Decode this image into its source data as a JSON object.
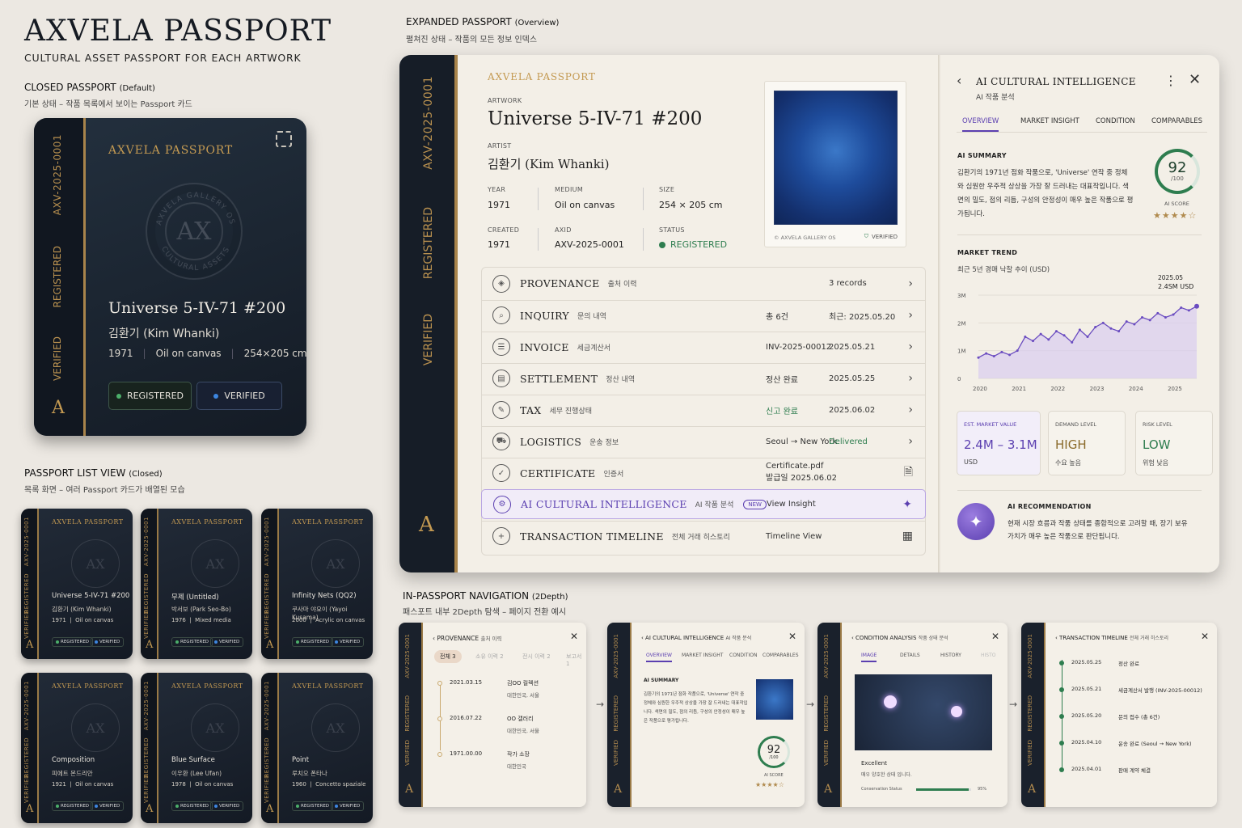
{
  "header": {
    "title": "AXVELA PASSPORT",
    "subtitle": "CULTURAL ASSET PASSPORT FOR EACH ARTWORK"
  },
  "closed": {
    "heading": "CLOSED PASSPORT",
    "heading_note": "(Default)",
    "desc": "기본 상태 – 작품 목록에서 보이는 Passport 카드",
    "spine": [
      "AXV-2025-0001",
      "REGISTERED",
      "VERIFIED"
    ],
    "brand": "AXVELA PASSPORT",
    "seal": "AX",
    "seal_ring_top": "AXVELA GALLERY OS",
    "seal_ring_bottom": "CULTURAL ASSETS",
    "title": "Universe 5-IV-71 #200",
    "artist": "김환기 (Kim Whanki)",
    "year": "1971",
    "medium": "Oil on canvas",
    "size": "254×205 cm",
    "badge1": "REGISTERED",
    "badge2": "VERIFIED",
    "logo": "A"
  },
  "list": {
    "heading": "PASSPORT LIST VIEW",
    "heading_note": "(Closed)",
    "desc": "목록 화면 – 여러 Passport 카드가 배열된 모습",
    "cards": [
      {
        "brand": "AXVELA PASSPORT",
        "spine": "AXV-2025-0001",
        "title": "Universe 5-IV-71 #200",
        "artist": "김환기 (Kim Whanki)",
        "year": "1971",
        "medium": "Oil on canvas",
        "b1": "REGISTERED",
        "b2": "VERIFIED"
      },
      {
        "brand": "AXVELA PASSPORT",
        "spine": "AXV-2025-0001",
        "title": "무제 (Untitled)",
        "artist": "박서보 (Park Seo-Bo)",
        "year": "1976",
        "medium": "Mixed media",
        "b1": "REGISTERED",
        "b2": "VERIFIED"
      },
      {
        "brand": "AXVELA PASSPORT",
        "spine": "AXV-2025-0001",
        "title": "Infinity Nets (QQ2)",
        "artist": "쿠사마 야요이 (Yayoi Kusama)",
        "year": "2000",
        "medium": "Acrylic on canvas",
        "b1": "REGISTERED",
        "b2": "VERIFIED"
      },
      {
        "brand": "AXVELA PASSPORT",
        "spine": "AXV-2025-0001",
        "title": "Composition",
        "artist": "피에트 몬드리안",
        "year": "1921",
        "medium": "Oil on canvas",
        "b1": "REGISTERED",
        "b2": "VERIFIED"
      },
      {
        "brand": "AXVELA PASSPORT",
        "spine": "AXV-2025-0001",
        "title": "Blue Surface",
        "artist": "이우환 (Lee Ufan)",
        "year": "1978",
        "medium": "Oil on canvas",
        "b1": "REGISTERED",
        "b2": "VERIFIED"
      },
      {
        "brand": "AXVELA PASSPORT",
        "spine": "AXV-2025-0001",
        "title": "Point",
        "artist": "루치오 폰타나",
        "year": "1960",
        "medium": "Concetto spaziale",
        "b1": "REGISTERED",
        "b2": "VERIFIED"
      }
    ]
  },
  "expanded": {
    "heading": "EXPANDED PASSPORT",
    "heading_note": "(Overview)",
    "desc": "펼쳐진 상태 – 작품의 모든 정보 인덱스",
    "spine": [
      "AXV-2025-0001",
      "REGISTERED",
      "VERIFIED"
    ],
    "logo": "A",
    "brand": "AXVELA PASSPORT",
    "artwork_label": "ARTWORK",
    "title": "Universe 5-IV-71 #200",
    "artist_label": "ARTIST",
    "artist": "김환기 (Kim Whanki)",
    "fields": {
      "year_l": "YEAR",
      "year": "1971",
      "medium_l": "MEDIUM",
      "medium": "Oil on canvas",
      "size_l": "SIZE",
      "size": "254 × 205 cm",
      "created_l": "CREATED",
      "created": "1971",
      "axid_l": "AXID",
      "axid": "AXV-2025-0001",
      "status_l": "STATUS",
      "status": "REGISTERED"
    },
    "image_caption": "© AXVELA GALLERY OS",
    "image_verified": "VERIFIED",
    "rows": [
      {
        "t": "PROVENANCE",
        "k": "출처 이력",
        "v1": "",
        "v2": "3 records"
      },
      {
        "t": "INQUIRY",
        "k": "문의 내역",
        "v1": "총 6건",
        "v2": "최근: 2025.05.20"
      },
      {
        "t": "INVOICE",
        "k": "세금계산서",
        "v1": "INV-2025-00012",
        "v2": "2025.05.21"
      },
      {
        "t": "SETTLEMENT",
        "k": "정산 내역",
        "v1": "정산 완료",
        "v2": "2025.05.25"
      },
      {
        "t": "TAX",
        "k": "세무 진행상태",
        "v1": "신고 완료",
        "v2": "2025.06.02"
      },
      {
        "t": "LOGISTICS",
        "k": "운송 정보",
        "v1": "Seoul → New York",
        "v2": "Delivered"
      },
      {
        "t": "CERTIFICATE",
        "k": "인증서",
        "v1": "Certificate.pdf",
        "v1b": "발급일 2025.06.02",
        "v2": ""
      },
      {
        "t": "AI CULTURAL INTELLIGENCE",
        "k": "AI 작품 분석",
        "badge": "NEW",
        "v1": "View Insight",
        "v2": ""
      },
      {
        "t": "TRANSACTION TIMELINE",
        "k": "전체 거래 히스토리",
        "v1": "Timeline View",
        "v2": ""
      }
    ]
  },
  "ai": {
    "title": "AI CULTURAL INTELLIGENCE",
    "subtitle": "AI 작품 분석",
    "tabs": [
      "OVERVIEW",
      "MARKET INSIGHT",
      "CONDITION",
      "COMPARABLES"
    ],
    "summary_label": "AI SUMMARY",
    "summary": "김환기의 1971년 점화 작품으로, 'Universe' 연작 중 정체와 심원한 우주적 상상을 가장 잘 드러내는 대표작입니다. 색면의 밀도, 점의 리듬, 구성의 안정성이 매우 높은 작품으로 평가됩니다.",
    "score": "92",
    "score_max": "/100",
    "score_label": "AI SCORE",
    "stars": "★★★★☆",
    "trend_label": "MARKET TREND",
    "trend_desc": "최근 5년 경매 낙찰 추이 (USD)",
    "tip_date": "2025.05",
    "tip_value": "2.4SM USD",
    "metrics": [
      {
        "l": "EST. MARKET VALUE",
        "v": "2.4M – 3.1M",
        "s": "USD"
      },
      {
        "l": "DEMAND LEVEL",
        "v": "HIGH",
        "s": "수요 높음"
      },
      {
        "l": "RISK LEVEL",
        "v": "LOW",
        "s": "위험 낮음"
      }
    ],
    "rec_label": "AI RECOMMENDATION",
    "rec": "현재 시장 흐름과 작품 상태를 종합적으로 고려할 때, 장기 보유 가치가 매우 높은 작품으로 판단됩니다.",
    "colors": {
      "accent": "#5b3fb0",
      "green": "#2e7d4f"
    }
  },
  "chart_data": {
    "type": "area",
    "x": [
      2020,
      2020.2,
      2020.4,
      2020.6,
      2020.8,
      2021,
      2021.2,
      2021.4,
      2021.6,
      2021.8,
      2022,
      2022.2,
      2022.4,
      2022.6,
      2022.8,
      2023,
      2023.2,
      2023.4,
      2023.6,
      2023.8,
      2024,
      2024.2,
      2024.4,
      2024.6,
      2024.8,
      2025,
      2025.2,
      2025.4,
      2025.6
    ],
    "values": [
      0.75,
      0.9,
      0.8,
      0.95,
      0.85,
      1.0,
      1.5,
      1.35,
      1.6,
      1.4,
      1.7,
      1.55,
      1.3,
      1.75,
      1.5,
      1.85,
      2.0,
      1.8,
      1.7,
      2.05,
      1.95,
      2.2,
      2.1,
      2.35,
      2.2,
      2.3,
      2.55,
      2.45,
      2.6
    ],
    "ylim": [
      0,
      3
    ],
    "yticks": [
      "0",
      "1M",
      "2M",
      "3M"
    ],
    "xticks": [
      "2020",
      "2021",
      "2022",
      "2023",
      "2024",
      "2025"
    ],
    "xlabel": "",
    "ylabel": ""
  },
  "nav": {
    "heading": "IN-PASSPORT NAVIGATION",
    "heading_note": "(2Depth)",
    "desc": "패스포트 내부 2Depth 탐색 – 페이지 전환 예시",
    "prov": {
      "title": "PROVENANCE",
      "kr": "출처 이력",
      "tabs": [
        "전체 3",
        "소유 이력 2",
        "전시 이력 2",
        "보고서 1"
      ],
      "items": [
        {
          "d": "2021.03.15",
          "a": "김OO 컬렉션",
          "b": "대한민국, 서울"
        },
        {
          "d": "2016.07.22",
          "a": "OO 갤러리",
          "b": "대한민국, 서울"
        },
        {
          "d": "1971.00.00",
          "a": "작가 소장",
          "b": "대한민국"
        }
      ]
    },
    "aip": {
      "title": "AI CULTURAL INTELLIGENCE",
      "kr": "AI 작품 분석",
      "tabs": [
        "OVERVIEW",
        "MARKET INSIGHT",
        "CONDITION",
        "COMPARABLES"
      ],
      "summary_label": "AI SUMMARY",
      "summary": "김환기의 1971년 점화 작품으로, 'Universe' 연작 중 정체와 심원한 우주적 상상을 가장 잘 드러내는 대표작입니다. 색면의 밀도, 점의 리듬, 구성의 안정성이 매우 높은 작품으로 평가됩니다.",
      "score": "92",
      "max": "/100",
      "sl": "AI SCORE",
      "stars": "★★★★☆"
    },
    "cond": {
      "title": "CONDITION ANALYSIS",
      "kr": "작품 상태 분석",
      "tabs": [
        "IMAGE",
        "DETAILS",
        "HISTORY",
        "HISTO"
      ],
      "state": "Excellent",
      "state_desc": "매우 양호한 상태 입니다.",
      "bar_label": "Conservation Status",
      "pct": "95%",
      "pct_value": 95
    },
    "tl": {
      "title": "TRANSACTION TIMELINE",
      "kr": "전체 거래 히스토리",
      "items": [
        {
          "d": "2025.05.25",
          "t": "정산 완료"
        },
        {
          "d": "2025.05.21",
          "t": "세금계산서 발행 (INV-2025-00012)"
        },
        {
          "d": "2025.05.20",
          "t": "문의 접수 (총 6건)"
        },
        {
          "d": "2025.04.10",
          "t": "운송 완료 (Seoul → New York)"
        },
        {
          "d": "2025.04.01",
          "t": "판매 계약 체결"
        }
      ]
    },
    "spine": [
      "AXV-2025-0001",
      "REGISTERED",
      "VERIFIED"
    ],
    "logo": "A"
  }
}
